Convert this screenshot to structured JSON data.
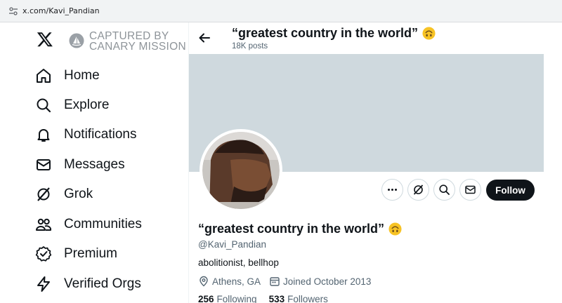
{
  "browser": {
    "url": "x.com/Kavi_Pandian"
  },
  "sidebar": {
    "watermark_line1": "CAPTURED BY",
    "watermark_line2": "CANARY MISSION",
    "items": [
      {
        "label": "Home",
        "icon": "home-icon"
      },
      {
        "label": "Explore",
        "icon": "search-icon"
      },
      {
        "label": "Notifications",
        "icon": "bell-icon"
      },
      {
        "label": "Messages",
        "icon": "envelope-icon"
      },
      {
        "label": "Grok",
        "icon": "grok-icon"
      },
      {
        "label": "Communities",
        "icon": "communities-icon"
      },
      {
        "label": "Premium",
        "icon": "premium-badge-icon"
      },
      {
        "label": "Verified Orgs",
        "icon": "lightning-icon"
      }
    ]
  },
  "header": {
    "title": "“greatest country in the world”",
    "posts": "18K posts"
  },
  "profile": {
    "display_name": "“greatest country in the world”",
    "handle": "@Kavi_Pandian",
    "bio": "abolitionist, bellhop",
    "location": "Athens, GA",
    "joined": "Joined October 2013",
    "following_count": "256",
    "following_label": "Following",
    "followers_count": "533",
    "followers_label": "Followers",
    "follow_button": "Follow",
    "emoji": "upside-down-face-emoji"
  },
  "colors": {
    "banner": "#cfd9de",
    "follow_bg": "#0f1419",
    "secondary_text": "#536471",
    "emoji": "#f7c325"
  }
}
